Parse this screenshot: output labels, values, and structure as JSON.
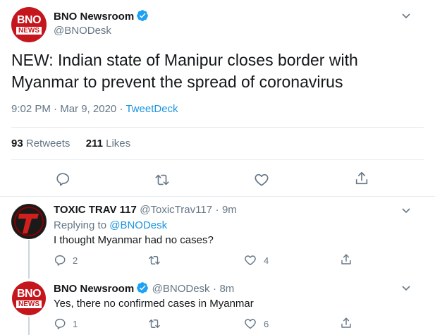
{
  "main_tweet": {
    "author_name": "BNO Newsroom",
    "author_handle": "@BNODesk",
    "avatar": {
      "top": "BNO",
      "bottom": "NEWS"
    },
    "text": "NEW: Indian state of Manipur closes border with Myanmar to prevent the spread of coronavirus",
    "time": "9:02 PM",
    "sep1": "·",
    "date": "Mar 9, 2020",
    "sep2": "·",
    "source": "TweetDeck",
    "retweets_count": "93",
    "retweets_label": "Retweets",
    "likes_count": "211",
    "likes_label": "Likes"
  },
  "replies": [
    {
      "author_name": "TOXIC TRAV 117",
      "author_handle": "@ToxicTrav117",
      "sep": "·",
      "time": "9m",
      "replying_label": "Replying to",
      "replying_handle": "@BNODesk",
      "text": "I thought Myanmar had no cases?",
      "reply_count": "2",
      "like_count": "4"
    },
    {
      "author_name": "BNO Newsroom",
      "author_handle": "@BNODesk",
      "avatar": {
        "top": "BNO",
        "bottom": "NEWS"
      },
      "sep": "·",
      "time": "8m",
      "text": "Yes, there no confirmed cases in Myanmar",
      "reply_count": "1",
      "like_count": "6"
    }
  ],
  "colors": {
    "brand_red": "#c4161c",
    "verified_blue": "#1da1f2",
    "link_blue": "#1b95e0",
    "muted": "#657786"
  }
}
